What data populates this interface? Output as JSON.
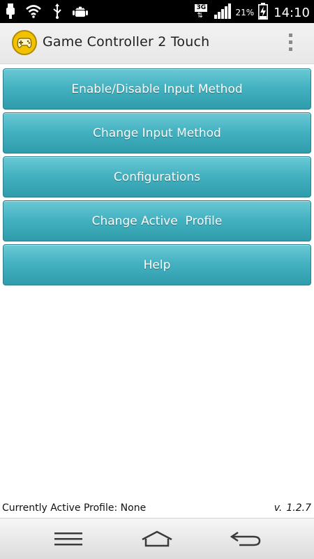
{
  "status_bar": {
    "icons": [
      "usb-icon",
      "wifi-icon",
      "usb-debug-icon",
      "android-debug-icon",
      "network-3g-icon",
      "signal-icon",
      "battery-charging-icon"
    ],
    "network_type": "3G",
    "battery_percent": "21%",
    "time": "14:10"
  },
  "action_bar": {
    "app_icon": "gamepad-icon",
    "title": "Game Controller 2 Touch",
    "overflow_icon": "overflow-menu-icon"
  },
  "menu": {
    "items": [
      {
        "label": "Enable/Disable Input Method"
      },
      {
        "label": "Change Input Method"
      },
      {
        "label": "Configurations"
      },
      {
        "label": "Change Active  Profile"
      },
      {
        "label": "Help"
      }
    ]
  },
  "footer": {
    "active_profile": "Currently Active Profile: None",
    "version_prefix": "v.",
    "version_number": "1.2.7"
  },
  "nav_bar": {
    "icons": [
      "menu-icon",
      "home-icon",
      "back-icon"
    ]
  },
  "colors": {
    "button_top": "#6ac9d5",
    "button_bottom": "#2e9cab",
    "button_border": "#2c7f8c",
    "app_icon_yellow": "#f2c200",
    "status_bar": "#000000"
  }
}
